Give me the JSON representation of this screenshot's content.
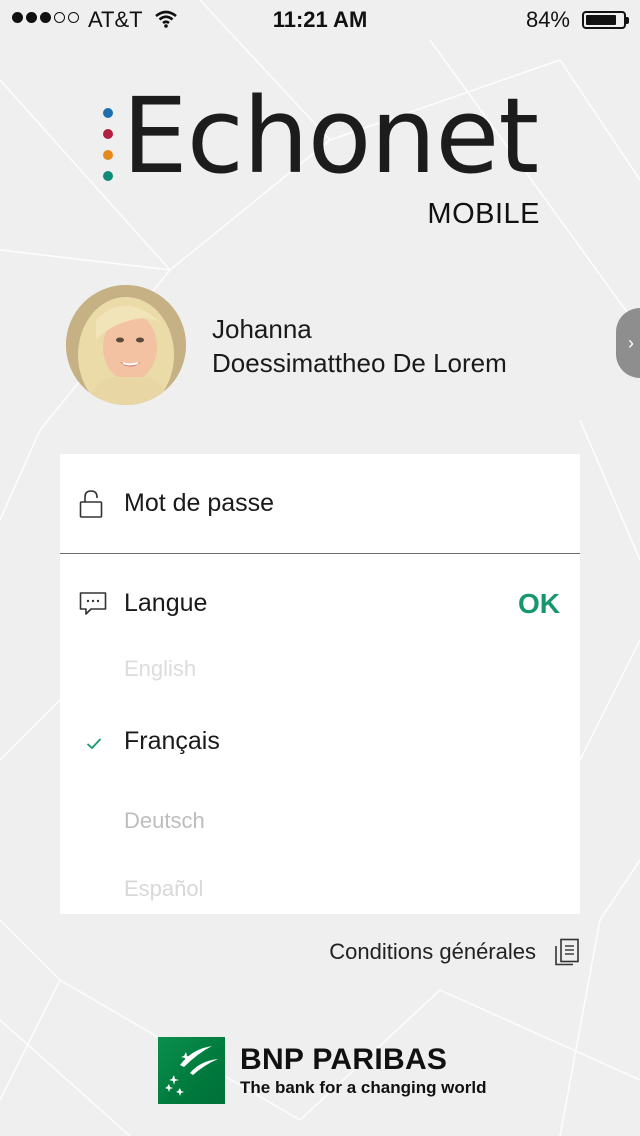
{
  "status_bar": {
    "carrier": "AT&T",
    "time": "11:21 AM",
    "battery_percent_text": "84%",
    "battery_level": 0.84,
    "signal_bars_filled": 3,
    "signal_bars_total": 5
  },
  "logo": {
    "wordmark": "Echonet",
    "subtitle": "MOBILE",
    "dot_colors": [
      "#1f6fae",
      "#b3203f",
      "#e48a1d",
      "#0f8a78"
    ]
  },
  "user": {
    "first_name": "Johanna",
    "last_name": "Doessimattheo De Lorem"
  },
  "form": {
    "password_label": "Mot de passe",
    "language_label": "Langue",
    "ok_label": "OK",
    "languages": [
      "English",
      "Français",
      "Deutsch",
      "Español"
    ],
    "selected_language": "Français"
  },
  "footer": {
    "conditions_label": "Conditions générales",
    "bank_name": "BNP PARIBAS",
    "bank_tagline": "The bank for a changing world"
  },
  "colors": {
    "accent": "#17986a",
    "background": "#efefef",
    "bnp_green": "#007a3d"
  },
  "icons": {
    "lock": "unlock-icon",
    "language": "speech-bubble-icon",
    "check": "checkmark-icon",
    "conditions": "document-icon",
    "next": "chevron-right-icon",
    "wifi": "wifi-icon"
  }
}
